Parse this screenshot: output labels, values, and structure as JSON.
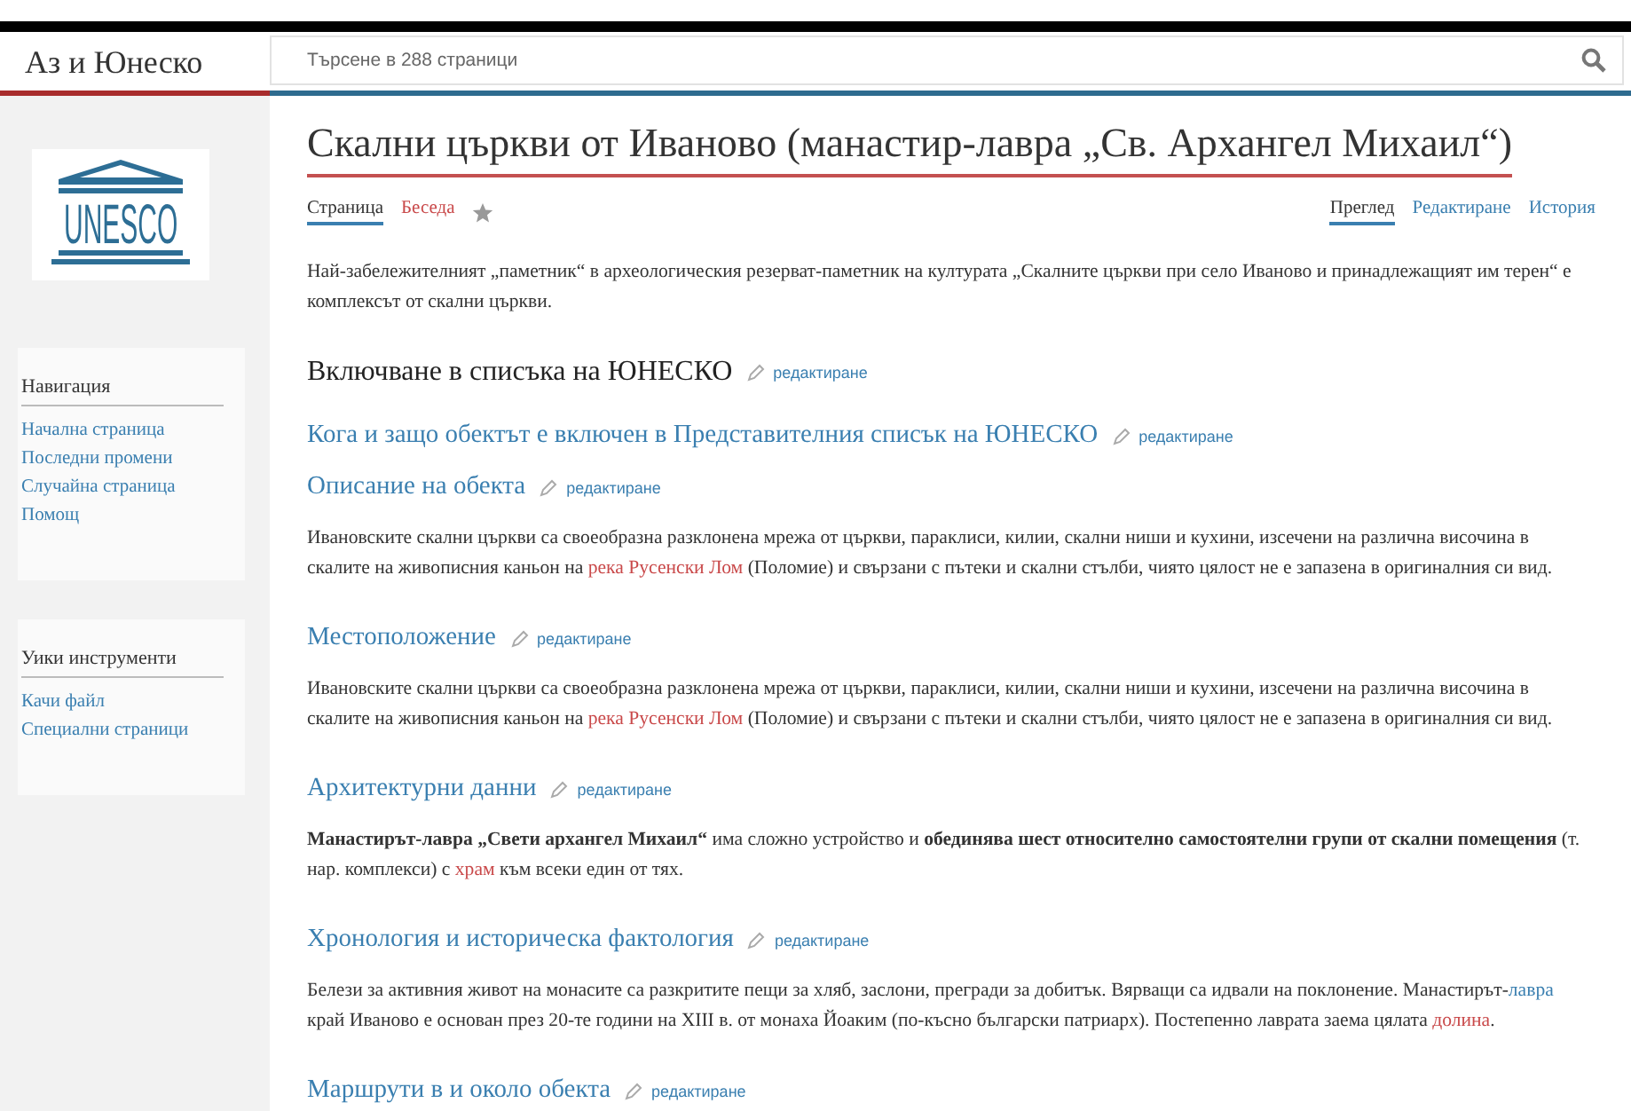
{
  "site_title": "Аз и Юнеско",
  "search": {
    "placeholder": "Търсене в 288 страници"
  },
  "logo": {
    "text": "UNESCO"
  },
  "sidebar": [
    {
      "title": "Навигация",
      "items": [
        "Начална страница",
        "Последни промени",
        "Случайна страница",
        "Помощ"
      ]
    },
    {
      "title": "Уики инструменти",
      "items": [
        "Качи файл",
        "Специални страници"
      ]
    }
  ],
  "page_title": "Скални църкви от Иваново (манастир-лавра „Св. Архангел Михаил“)",
  "left_tabs": [
    {
      "label": "Страница",
      "selected": true,
      "missing": false
    },
    {
      "label": "Беседа",
      "selected": false,
      "missing": true
    }
  ],
  "right_tabs": [
    {
      "label": "Преглед",
      "selected": true
    },
    {
      "label": "Редактиране",
      "selected": false
    },
    {
      "label": "История",
      "selected": false
    }
  ],
  "content": [
    {
      "kind": "paragraph",
      "segments": [
        {
          "kind": "text",
          "text": "Най-забележителният „паметник“ в археологическия резерват-паметник на културата „Скалните църкви при село Иваново и принадлежащият им терен“ е комплексът от скални църкви."
        }
      ]
    },
    {
      "kind": "heading",
      "text": "Включване в списъка на ЮНЕСКО",
      "edit": "редактиране"
    },
    {
      "kind": "subheading",
      "text": "Кога и защо обектът е включен в Представителния списък на ЮНЕСКО",
      "edit": "редактиране"
    },
    {
      "kind": "subheading",
      "text": "Описание на обекта",
      "edit": "редактиране"
    },
    {
      "kind": "paragraph",
      "segments": [
        {
          "kind": "text",
          "text": "Ивановските скални църкви са своеобразна разклонена мрежа от църкви, параклиси, килии, скални ниши и кухини, изсечени на различна височина в скалите на живописния каньон на "
        },
        {
          "kind": "missing_link",
          "text": "река Русенски Лом"
        },
        {
          "kind": "text",
          "text": " (Поломие) и свързани с пътеки и скални стълби, чиято цялост не е запазена в оригиналния си вид."
        }
      ]
    },
    {
      "kind": "subheading",
      "text": "Местоположение",
      "edit": "редактиране"
    },
    {
      "kind": "paragraph",
      "segments": [
        {
          "kind": "text",
          "text": "Ивановските скални църкви са своеобразна разклонена мрежа от църкви, параклиси, килии, скални ниши и кухини, изсечени на различна височина в скалите на живописния каньон на "
        },
        {
          "kind": "missing_link",
          "text": "река Русенски Лом"
        },
        {
          "kind": "text",
          "text": " (Поломие) и свързани с пътеки и скални стълби, чиято цялост не е запазена в оригиналния си вид."
        }
      ]
    },
    {
      "kind": "subheading",
      "text": "Архитектурни данни",
      "edit": "редактиране"
    },
    {
      "kind": "paragraph",
      "segments": [
        {
          "kind": "text",
          "text": "**Манастирът-лавра „Свети архангел Михаил“** има сложно устройство и **обединява шест относително самостоятелни групи от скални помещения** (т. нар. комплекси) с "
        },
        {
          "kind": "missing_link",
          "text": "храм"
        },
        {
          "kind": "text",
          "text": " към всеки един от тях."
        }
      ]
    },
    {
      "kind": "subheading",
      "text": "Хронология и историческа фактология",
      "edit": "редактиране"
    },
    {
      "kind": "paragraph",
      "segments": [
        {
          "kind": "text",
          "text": "Белези за активния живот на монасите са разкритите пещи за хляб, заслони, прегради за добитък. Вярващи са идвали на поклонение. Манастирът-"
        },
        {
          "kind": "link",
          "text": "лавра"
        },
        {
          "kind": "text",
          "text": " край Иваново е основан през 20-те години на XIII в. от монаха Йоаким (по-късно български патриарх). Постепенно лаврата заема цялата "
        },
        {
          "kind": "missing_link",
          "text": "долина"
        },
        {
          "kind": "text",
          "text": "."
        }
      ]
    },
    {
      "kind": "subheading",
      "text": "Маршрути в и около обекта",
      "edit": "редактиране"
    }
  ]
}
